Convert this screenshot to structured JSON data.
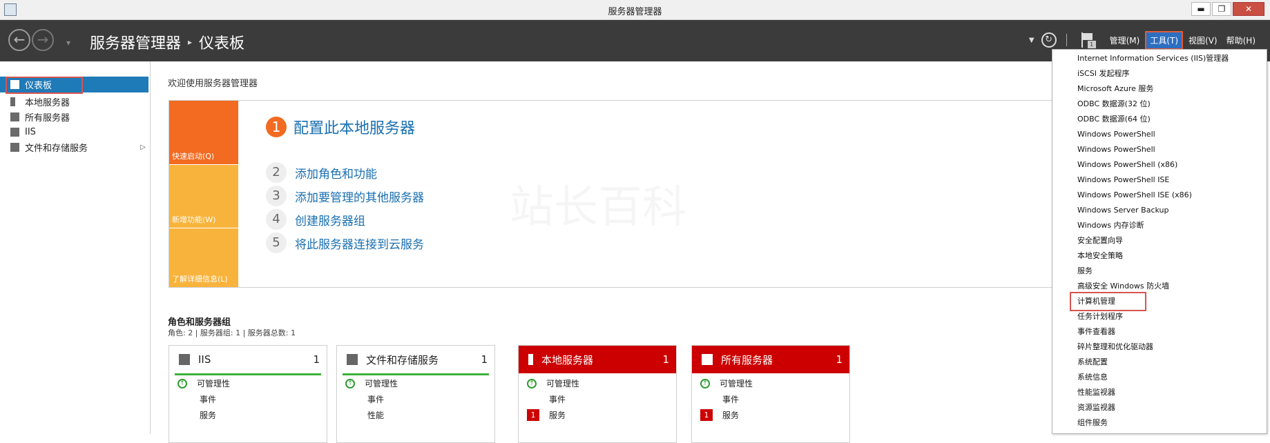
{
  "window": {
    "title": "服务器管理器"
  },
  "window_buttons": {
    "minimize": "▬",
    "restore": "❐",
    "close": "✕"
  },
  "breadcrumb": {
    "app": "服务器管理器",
    "arrow": "▸",
    "page": "仪表板"
  },
  "header": {
    "flag_count": "1",
    "menus": [
      {
        "label": "管理(M)"
      },
      {
        "label": "工具(T)"
      },
      {
        "label": "视图(V)"
      },
      {
        "label": "帮助(H)"
      }
    ]
  },
  "sidebar": {
    "items": [
      {
        "label": "仪表板",
        "icon": "dashboard-icon"
      },
      {
        "label": "本地服务器",
        "icon": "server-icon"
      },
      {
        "label": "所有服务器",
        "icon": "servers-icon"
      },
      {
        "label": "IIS",
        "icon": "iis-icon"
      },
      {
        "label": "文件和存储服务",
        "icon": "file-storage-icon",
        "expand": "▷"
      }
    ]
  },
  "welcome": {
    "title": "欢迎使用服务器管理器"
  },
  "tiles": {
    "quick_start": "快速启动(Q)",
    "whats_new": "新增功能(W)",
    "learn_more": "了解详细信息(L)"
  },
  "steps": [
    {
      "num": "1",
      "label": "配置此本地服务器"
    },
    {
      "num": "2",
      "label": "添加角色和功能"
    },
    {
      "num": "3",
      "label": "添加要管理的其他服务器"
    },
    {
      "num": "4",
      "label": "创建服务器组"
    },
    {
      "num": "5",
      "label": "将此服务器连接到云服务"
    }
  ],
  "roles": {
    "title": "角色和服务器组",
    "subtitle": "角色: 2 | 服务器组: 1 | 服务器总数: 1",
    "cards": [
      {
        "name": "IIS",
        "count": "1",
        "rows": [
          "可管理性",
          "事件",
          "服务"
        ]
      },
      {
        "name": "文件和存储服务",
        "count": "1",
        "rows": [
          "可管理性",
          "事件",
          "性能"
        ]
      },
      {
        "name": "本地服务器",
        "count": "1",
        "rows": [
          "可管理性",
          "事件",
          "服务"
        ],
        "badge": "1"
      },
      {
        "name": "所有服务器",
        "count": "1",
        "rows": [
          "可管理性",
          "事件",
          "服务"
        ],
        "badge": "1"
      }
    ]
  },
  "tools_menu": {
    "items": [
      "Internet Information Services (IIS)管理器",
      "iSCSI 发起程序",
      "Microsoft Azure 服务",
      "ODBC 数据源(32 位)",
      "ODBC 数据源(64 位)",
      "Windows PowerShell",
      "Windows PowerShell",
      "Windows PowerShell (x86)",
      "Windows PowerShell ISE",
      "Windows PowerShell ISE (x86)",
      "Windows Server Backup",
      "Windows 内存诊断",
      "安全配置向导",
      "本地安全策略",
      "服务",
      "高级安全 Windows 防火墙",
      "计算机管理",
      "任务计划程序",
      "事件查看器",
      "碎片整理和优化驱动器",
      "系统配置",
      "系统信息",
      "性能监视器",
      "资源监视器",
      "组件服务"
    ]
  },
  "watermark": "站长百科"
}
